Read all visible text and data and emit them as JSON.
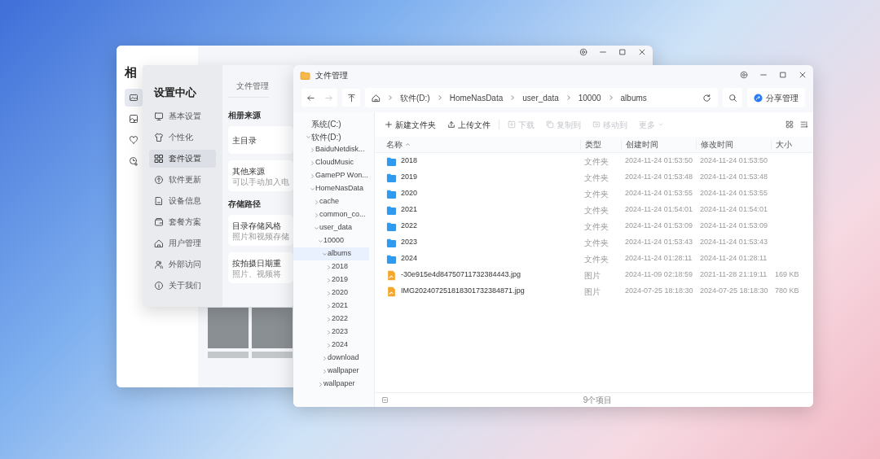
{
  "album_window": {
    "title": "相"
  },
  "settings": {
    "title": "设置中心",
    "menu": [
      {
        "label": "基本设置",
        "selected": false
      },
      {
        "label": "个性化",
        "selected": false
      },
      {
        "label": "套件设置",
        "selected": true
      },
      {
        "label": "软件更新",
        "selected": false
      },
      {
        "label": "设备信息",
        "selected": false
      },
      {
        "label": "套餐方案",
        "selected": false
      },
      {
        "label": "用户管理",
        "selected": false
      },
      {
        "label": "外部访问",
        "selected": false
      },
      {
        "label": "关于我们",
        "selected": false
      }
    ],
    "tab": "文件管理",
    "sections": [
      {
        "title": "相册来源",
        "cards": [
          {
            "title": "主目录"
          },
          {
            "title": "其他来源",
            "description": "可以手动加入电"
          }
        ]
      },
      {
        "title": "存储路径",
        "cards": [
          {
            "title": "目录存储风格",
            "description": "照片和视频存储"
          },
          {
            "title": "按拍摄日期重",
            "description": "照片、视频将"
          }
        ]
      }
    ]
  },
  "file_manager": {
    "title": "文件管理",
    "breadcrumb": [
      "软件(D:)",
      "HomeNasData",
      "user_data",
      "10000",
      "albums"
    ],
    "share_button": "分享管理",
    "actions": [
      {
        "label": "新建文件夹",
        "disabled": false,
        "dropdown": false
      },
      {
        "label": "上传文件",
        "disabled": false,
        "dropdown": false
      },
      {
        "label": "下载",
        "disabled": true,
        "dropdown": false
      },
      {
        "label": "复制到",
        "disabled": true,
        "dropdown": false
      },
      {
        "label": "移动到",
        "disabled": true,
        "dropdown": false
      },
      {
        "label": "更多",
        "disabled": true,
        "dropdown": true
      }
    ],
    "tree": [
      {
        "label": "系统(C:)",
        "selected": false
      },
      {
        "label": "软件(D:)",
        "expanded": true,
        "selected": false,
        "children": [
          {
            "label": "BaiduNetdisk...",
            "expanded": false,
            "selected": false
          },
          {
            "label": "CloudMusic",
            "expanded": false,
            "selected": false
          },
          {
            "label": "GamePP Won...",
            "expanded": false,
            "selected": false
          },
          {
            "label": "HomeNasData",
            "expanded": true,
            "selected": false,
            "children": [
              {
                "label": "cache",
                "expanded": false,
                "selected": false
              },
              {
                "label": "common_co...",
                "expanded": false,
                "selected": false
              },
              {
                "label": "user_data",
                "expanded": true,
                "selected": false,
                "children": [
                  {
                    "label": "10000",
                    "expanded": true,
                    "selected": false,
                    "children": [
                      {
                        "label": "albums",
                        "expanded": true,
                        "selected": true,
                        "children": [
                          {
                            "label": "2018",
                            "expanded": false,
                            "selected": false
                          },
                          {
                            "label": "2019",
                            "expanded": false,
                            "selected": false
                          },
                          {
                            "label": "2020",
                            "expanded": false,
                            "selected": false
                          },
                          {
                            "label": "2021",
                            "expanded": false,
                            "selected": false
                          },
                          {
                            "label": "2022",
                            "expanded": false,
                            "selected": false
                          },
                          {
                            "label": "2023",
                            "expanded": false,
                            "selected": false
                          },
                          {
                            "label": "2024",
                            "expanded": false,
                            "selected": false
                          }
                        ]
                      },
                      {
                        "label": "download",
                        "expanded": false,
                        "selected": false
                      },
                      {
                        "label": "wallpaper",
                        "expanded": false,
                        "selected": false
                      }
                    ]
                  },
                  {
                    "label": "wallpaper",
                    "expanded": false,
                    "selected": false
                  }
                ]
              }
            ]
          }
        ]
      }
    ],
    "columns": [
      {
        "label": "名称",
        "sorted": true
      },
      {
        "label": "类型",
        "sorted": false
      },
      {
        "label": "创建时间",
        "sorted": false
      },
      {
        "label": "修改时间",
        "sorted": false
      },
      {
        "label": "大小",
        "sorted": false
      }
    ],
    "rows": [
      {
        "kind": "folder",
        "name": "2018",
        "type": "文件夹",
        "created": "2024-11-24 01:53:50",
        "modified": "2024-11-24 01:53:50"
      },
      {
        "kind": "folder",
        "name": "2019",
        "type": "文件夹",
        "created": "2024-11-24 01:53:48",
        "modified": "2024-11-24 01:53:48"
      },
      {
        "kind": "folder",
        "name": "2020",
        "type": "文件夹",
        "created": "2024-11-24 01:53:55",
        "modified": "2024-11-24 01:53:55"
      },
      {
        "kind": "folder",
        "name": "2021",
        "type": "文件夹",
        "created": "2024-11-24 01:54:01",
        "modified": "2024-11-24 01:54:01"
      },
      {
        "kind": "folder",
        "name": "2022",
        "type": "文件夹",
        "created": "2024-11-24 01:53:09",
        "modified": "2024-11-24 01:53:09"
      },
      {
        "kind": "folder",
        "name": "2023",
        "type": "文件夹",
        "created": "2024-11-24 01:53:43",
        "modified": "2024-11-24 01:53:43"
      },
      {
        "kind": "folder",
        "name": "2024",
        "type": "文件夹",
        "created": "2024-11-24 01:28:11",
        "modified": "2024-11-24 01:28:11"
      },
      {
        "kind": "image",
        "name": "-30e915e4d84750711732384443.jpg",
        "type": "图片",
        "created": "2024-11-09 02:18:59",
        "modified": "2021-11-28 21:19:11",
        "size": "169 KB"
      },
      {
        "kind": "image",
        "name": "IMG202407251818301732384871.jpg",
        "type": "图片",
        "created": "2024-07-25 18:18:30",
        "modified": "2024-07-25 18:18:30",
        "size": "780 KB"
      }
    ],
    "status": "9个项目"
  }
}
